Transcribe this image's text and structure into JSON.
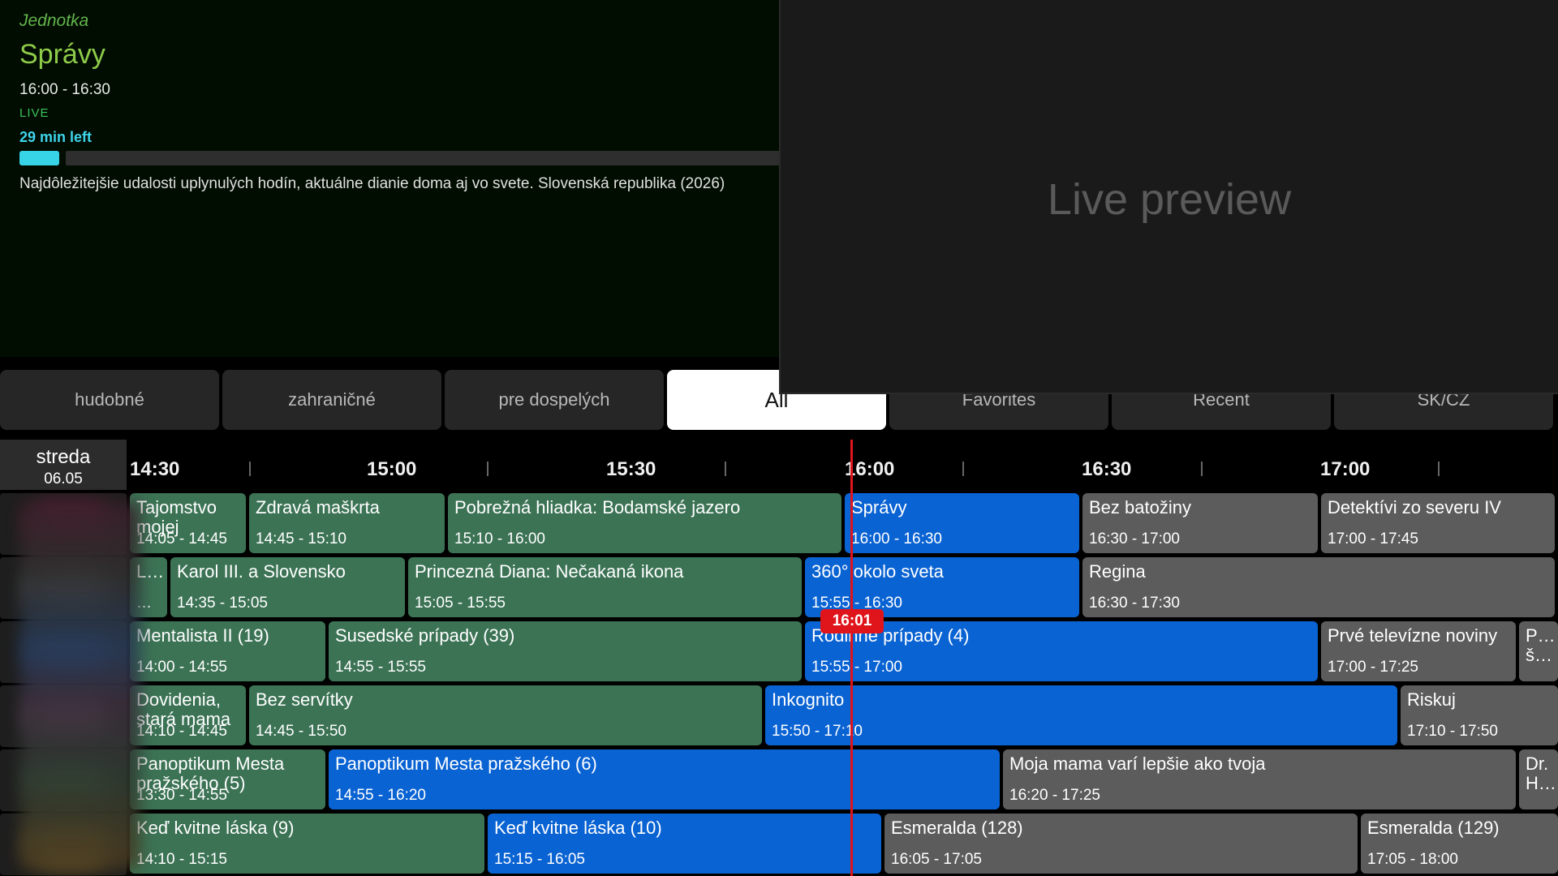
{
  "info": {
    "channel": "Jednotka",
    "title": "Správy",
    "time": "16:00 - 16:30",
    "live": "LIVE",
    "time_left": "29 min left",
    "progress_fraction": 0.03,
    "description": "Najdôležitejšie udalosti uplynulých hodín, aktuálne dianie doma aj vo svete. Slovenská republika (2026)"
  },
  "preview": {
    "label": "Live preview"
  },
  "tabs": [
    {
      "label": "hudobné",
      "active": false
    },
    {
      "label": "zahraničné",
      "active": false
    },
    {
      "label": "pre dospelých",
      "active": false
    },
    {
      "label": "All",
      "active": true
    },
    {
      "label": "Favorites",
      "active": false
    },
    {
      "label": "Recent",
      "active": false
    },
    {
      "label": "SK/CZ",
      "active": false
    }
  ],
  "date": {
    "day": "streda",
    "date": "06.05"
  },
  "timeline": [
    "14:30",
    "15:00",
    "15:30",
    "16:00",
    "16:30",
    "17:00"
  ],
  "now": "16:01",
  "colors": {
    "past": "#3c7355",
    "now": "#0a63d3",
    "future": "#5c5c5c",
    "now_line": "#e0141b",
    "accent": "#37d4e8"
  },
  "rows": [
    {
      "programs": [
        {
          "title": "Tajomstvo mojej",
          "time": "14:05 - 14:45",
          "state": "past"
        },
        {
          "title": "Zdravá maškrta",
          "time": "14:45 - 15:10",
          "state": "past"
        },
        {
          "title": "Pobrežná hliadka: Bodamské jazero",
          "time": "15:10 - 16:00",
          "state": "past"
        },
        {
          "title": "Správy",
          "time": "16:00 - 16:30",
          "state": "now"
        },
        {
          "title": "Bez batožiny",
          "time": "16:30 - 17:00",
          "state": "future"
        },
        {
          "title": "Detektívi zo severu IV",
          "time": "17:00 - 17:45",
          "state": "future"
        }
      ]
    },
    {
      "programs": [
        {
          "title": "L…",
          "time": "…",
          "state": "past"
        },
        {
          "title": "Karol III. a Slovensko",
          "time": "14:35 - 15:05",
          "state": "past"
        },
        {
          "title": "Princezná Diana: Nečakaná ikona",
          "time": "15:05 - 15:55",
          "state": "past"
        },
        {
          "title": "360° okolo sveta",
          "time": "15:55 - 16:30",
          "state": "now"
        },
        {
          "title": "Regina",
          "time": "16:30 - 17:30",
          "state": "future"
        }
      ]
    },
    {
      "programs": [
        {
          "title": "Mentalista II (19)",
          "time": "14:00 - 14:55",
          "state": "past"
        },
        {
          "title": "Susedské prípady (39)",
          "time": "14:55 - 15:55",
          "state": "past"
        },
        {
          "title": "Rodinné prípady (4)",
          "time": "15:55 - 17:00",
          "state": "now"
        },
        {
          "title": "Prvé televízne noviny",
          "time": "17:00 - 17:25",
          "state": "future"
        },
        {
          "title": "P… š…",
          "time": "",
          "state": "future"
        }
      ]
    },
    {
      "programs": [
        {
          "title": "Dovidenia, stará mama",
          "time": "14:10 - 14:45",
          "state": "past"
        },
        {
          "title": "Bez servítky",
          "time": "14:45 - 15:50",
          "state": "past"
        },
        {
          "title": "Inkognito",
          "time": "15:50 - 17:10",
          "state": "now"
        },
        {
          "title": "Riskuj",
          "time": "17:10 - 17:50",
          "state": "future"
        }
      ]
    },
    {
      "programs": [
        {
          "title": "Panoptikum Mesta pražského (5)",
          "time": "13:30 - 14:55",
          "state": "past"
        },
        {
          "title": "Panoptikum Mesta pražského (6)",
          "time": "14:55 - 16:20",
          "state": "now"
        },
        {
          "title": "Moja mama varí lepšie ako tvoja",
          "time": "16:20 - 17:25",
          "state": "future"
        },
        {
          "title": "Dr. H…",
          "time": "",
          "state": "future"
        }
      ]
    },
    {
      "programs": [
        {
          "title": "Keď kvitne láska (9)",
          "time": "14:10 - 15:15",
          "state": "past"
        },
        {
          "title": "Keď kvitne láska (10)",
          "time": "15:15 - 16:05",
          "state": "now"
        },
        {
          "title": "Esmeralda (128)",
          "time": "16:05 - 17:05",
          "state": "future"
        },
        {
          "title": "Esmeralda (129)",
          "time": "17:05 - 18:00",
          "state": "future"
        }
      ]
    }
  ]
}
